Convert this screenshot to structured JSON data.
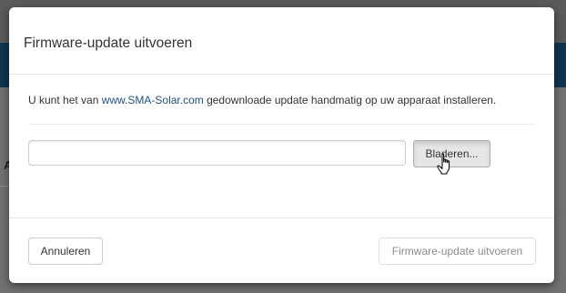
{
  "background": {
    "partial_letter": "A"
  },
  "dialog": {
    "title": "Firmware-update uitvoeren",
    "intro_before": "U kunt het van ",
    "intro_link": "www.SMA-Solar.com",
    "intro_after": " gedownloade update handmatig op uw apparaat installeren.",
    "file_input_value": "",
    "browse_label": "Bladeren...",
    "cancel_label": "Annuleren",
    "submit_label": "Firmware-update uitvoeren",
    "submit_disabled": true,
    "cursor_icon": "hand-pointer-icon",
    "colors": {
      "link": "#23527c",
      "header_band": "#0f3550"
    }
  }
}
